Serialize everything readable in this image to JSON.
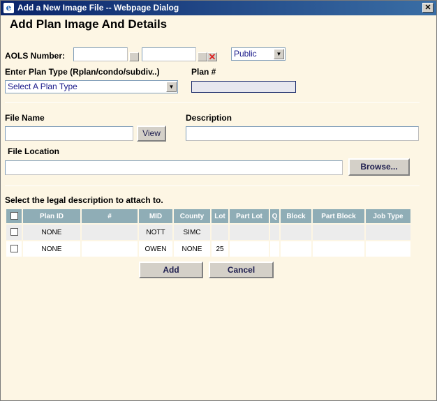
{
  "window": {
    "title": "Add a New Image File -- Webpage Dialog",
    "icon": "ie-icon",
    "close_glyph": "✕"
  },
  "heading": "Add Plan Image And Details",
  "aols": {
    "label": "AOLS Number:",
    "field1": "",
    "field2": "",
    "clear_glyph": "✕",
    "visibility": "Public"
  },
  "plan_type": {
    "label": "Enter Plan Type (Rplan/condo/subdiv..)",
    "selected": "Select A Plan Type"
  },
  "plan_number": {
    "label": "Plan #",
    "value": ""
  },
  "file": {
    "name_label": "File Name",
    "name_value": "",
    "view_label": "View",
    "description_label": "Description",
    "description_value": "",
    "location_label": "File Location",
    "location_value": "",
    "browse_label": "Browse..."
  },
  "legal": {
    "prompt": "Select the legal description to attach to.",
    "columns": [
      "Plan ID",
      "#",
      "MID",
      "County",
      "Lot",
      "Part Lot",
      "Q",
      "Block",
      "Part Block",
      "Job Type"
    ],
    "rows": [
      [
        "NONE",
        "",
        "NOTT",
        "SIMC",
        "",
        "",
        "",
        "",
        "",
        ""
      ],
      [
        "NONE",
        "",
        "OWEN",
        "NONE",
        "25",
        "",
        "",
        "",
        "",
        ""
      ]
    ]
  },
  "actions": {
    "add_label": "Add",
    "cancel_label": "Cancel"
  },
  "colors": {
    "title_start": "#0a246a",
    "title_end": "#3a6ea5",
    "dialog_bg": "#fdf6e4",
    "grid_header": "#8fadb6"
  }
}
